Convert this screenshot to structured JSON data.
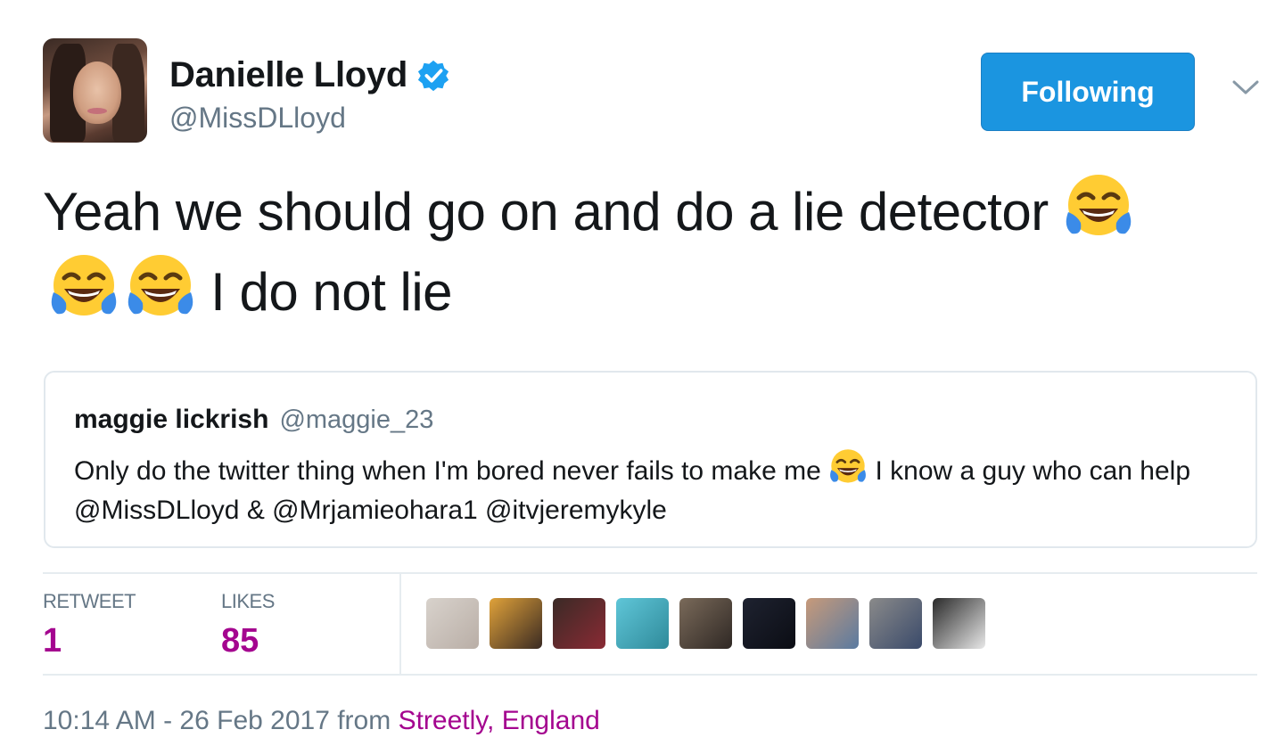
{
  "author": {
    "display_name": "Danielle Lloyd",
    "handle": "@MissDLloyd",
    "verified": true
  },
  "follow_button": {
    "label": "Following"
  },
  "tweet": {
    "text_part1": "Yeah we should go on and do a lie detector ",
    "text_part2": " I do not lie",
    "emoji": "face-with-tears-of-joy"
  },
  "quoted_tweet": {
    "name": "maggie lickrish",
    "handle": "@maggie_23",
    "text_part1": "Only do the twitter thing when I'm bored never fails to make me ",
    "text_part2": " I know a guy who can help @MissDLloyd  & @Mrjamieohara1  @itvjeremykyle"
  },
  "stats": {
    "retweet_label": "RETWEET",
    "retweet_count": "1",
    "likes_label": "LIKES",
    "likes_count": "85"
  },
  "likers": [
    {
      "name": "liker-1",
      "color_a": "#d8d2cc",
      "color_b": "#b9aea6"
    },
    {
      "name": "liker-2",
      "color_a": "#e0a23a",
      "color_b": "#3a2a22"
    },
    {
      "name": "liker-3",
      "color_a": "#3a2a26",
      "color_b": "#8a2a34"
    },
    {
      "name": "liker-4",
      "color_a": "#5fc6d8",
      "color_b": "#2f8a9a"
    },
    {
      "name": "liker-5",
      "color_a": "#7a6a5a",
      "color_b": "#2f2824"
    },
    {
      "name": "liker-6",
      "color_a": "#1e2230",
      "color_b": "#0b0d14"
    },
    {
      "name": "liker-7",
      "color_a": "#c79a7a",
      "color_b": "#5a7aa0"
    },
    {
      "name": "liker-8",
      "color_a": "#8a8a8a",
      "color_b": "#3a4a6a"
    },
    {
      "name": "liker-9",
      "color_a": "#2a2a2a",
      "color_b": "#e8e8e8"
    }
  ],
  "footer": {
    "time": "10:14 AM - 26 Feb 2017 from ",
    "location": "Streetly, England"
  },
  "colors": {
    "accent_blue": "#1b95e0",
    "stat_magenta": "#a4058f",
    "muted_gray": "#657786"
  }
}
